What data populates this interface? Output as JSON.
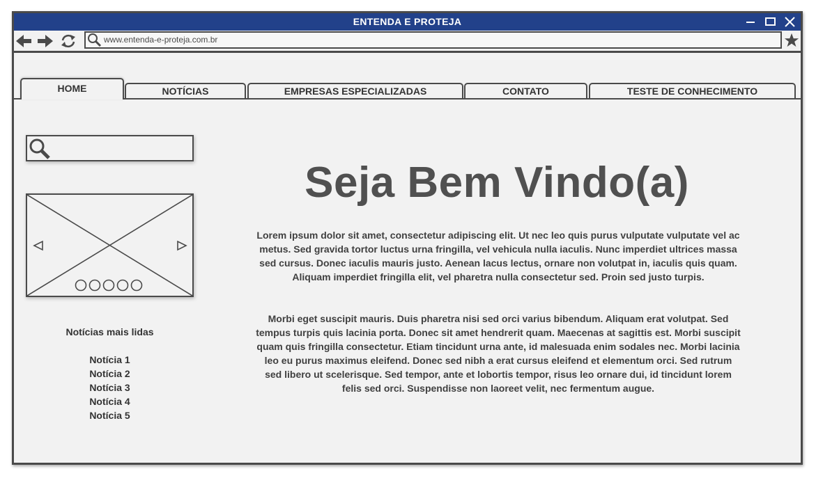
{
  "window": {
    "title": "ENTENDA E PROTEJA",
    "controls": [
      "minimize-icon",
      "maximize-icon",
      "close-icon"
    ]
  },
  "browser": {
    "url": "www.entenda-e-proteja.com.br",
    "icons": [
      "back-arrow-icon",
      "forward-arrow-icon",
      "refresh-icon",
      "search-icon",
      "star-icon"
    ]
  },
  "nav": {
    "tabs": [
      {
        "label": "HOME",
        "active": true
      },
      {
        "label": "NOTÍCIAS",
        "active": false
      },
      {
        "label": "EMPRESAS ESPECIALIZADAS",
        "active": false
      },
      {
        "label": "CONTATO",
        "active": false
      },
      {
        "label": "TESTE DE CONHECIMENTO",
        "active": false
      }
    ]
  },
  "sidebar": {
    "search_placeholder": "",
    "most_read_title": "Notícias mais lidas",
    "news": [
      "Notícia 1",
      "Notícia 2",
      "Notícia 3",
      "Notícia 4",
      "Notícia 5"
    ]
  },
  "main": {
    "title": "Seja Bem Vindo(a)",
    "paragraph1": "Lorem ipsum dolor sit amet, consectetur adipiscing elit. Ut nec leo quis purus vulputate vulputate vel ac metus. Sed gravida tortor luctus urna fringilla, vel vehicula nulla iaculis. Nunc imperdiet ultrices massa sed cursus. Donec iaculis mauris justo. Aenean lacus lectus, ornare non volutpat in, iaculis quis quam. Aliquam imperdiet fringilla elit, vel pharetra nulla consectetur sed. Proin sed justo turpis.",
    "paragraph2": "Morbi eget suscipit mauris. Duis pharetra nisi sed orci varius bibendum. Aliquam erat volutpat. Sed tempus turpis quis lacinia porta. Donec sit amet hendrerit quam. Maecenas at sagittis est. Morbi suscipit quam quis fringilla consectetur. Etiam tincidunt urna ante, id malesuada enim sodales nec. Morbi lacinia leo eu purus maximus eleifend. Donec sed nibh a erat cursus eleifend et elementum orci. Sed rutrum sed libero ut scelerisque. Sed tempor, ante et lobortis tempor, risus leo ornare dui, id tincidunt lorem felis sed orci. Suspendisse non laoreet velit, nec fermentum augue."
  },
  "colors": {
    "titlebar": "#22418a",
    "border": "#4a4a4a",
    "background": "#f2f2f2",
    "text": "#404040"
  }
}
